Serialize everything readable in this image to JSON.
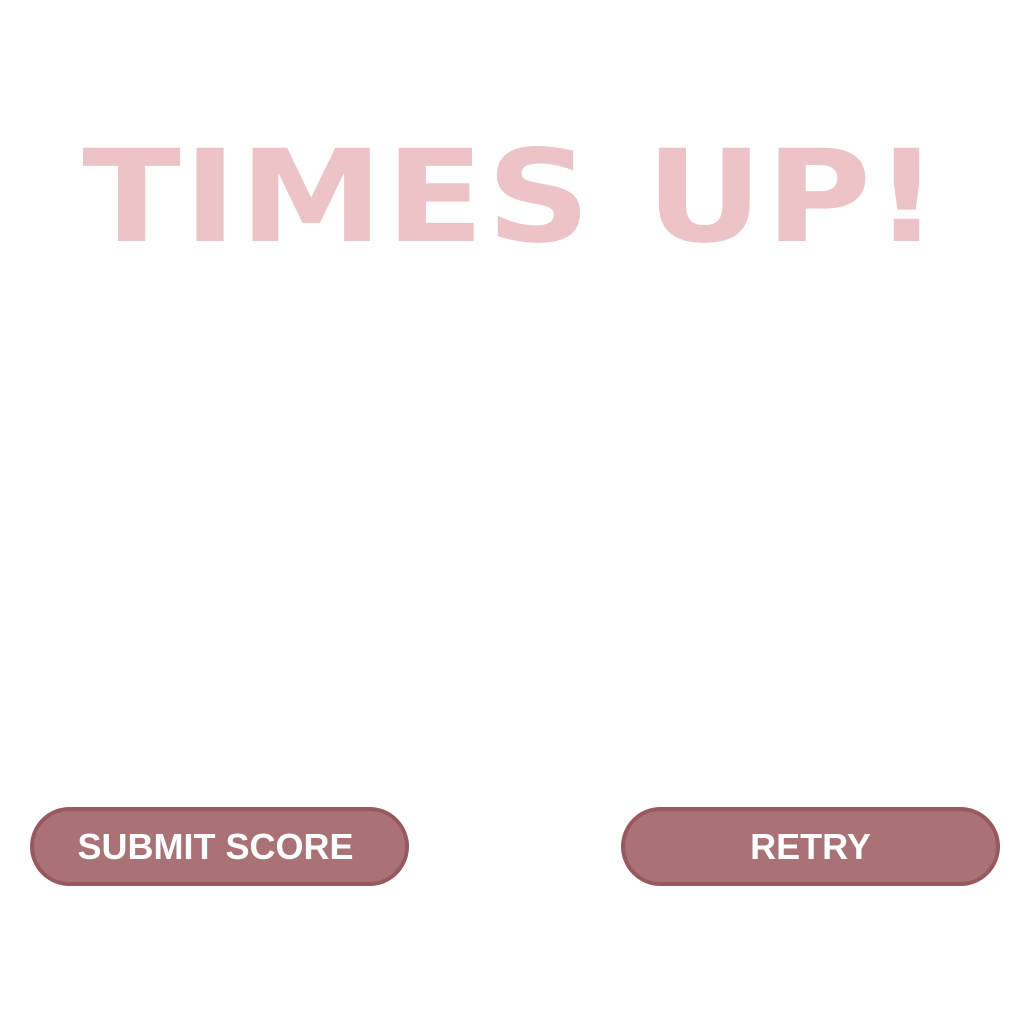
{
  "game_over": {
    "title": "TIMES UP!",
    "buttons": {
      "submit_label": "SUBMIT SCORE",
      "retry_label": "RETRY"
    }
  },
  "colors": {
    "background": "#ffffff",
    "title": "#ecc3c6",
    "button_fill": "#a87276",
    "button_border": "#97595f",
    "button_text": "#ffffff"
  }
}
